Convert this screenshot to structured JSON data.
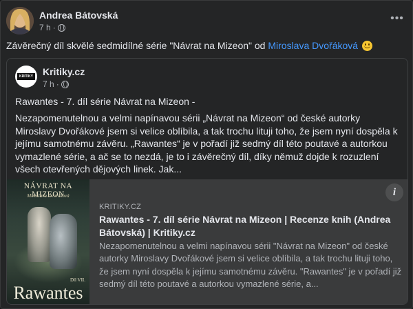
{
  "post": {
    "author": "Andrea Bátovská",
    "time": "7 h",
    "separator": "·",
    "more_label": "•••",
    "text_before": "Závěrečný díl skvělé sedmidílné série \"Návrat na Mizeon\" od ",
    "mention": "Miroslava Dvořáková",
    "emoji": "smiling-face-icon"
  },
  "shared": {
    "page_name": "Kritiky.cz",
    "time": "7 h",
    "separator": "·",
    "logo_text": "KRITIKY",
    "title": "Rawantes - 7. díl série Návrat na Mizeon -",
    "body": "Nezapomenutelnou a velmi napínavou sérii „Návrat na Mizeon“ od české autorky Miroslavy Dvořákové jsem si velice oblíbila, a tak trochu lituji toho, že jsem nyní dospěla k jejímu samotnému závěru. „Rawantes“ je v pořadí již sedmý díl této poutavé a autorkou vymazlené série, a ač se to nezdá, je to i závěrečný díl, díky němuž dojde k rozuzlení všech otevřených dějových linek. Jak..."
  },
  "link_card": {
    "domain": "KRITIKY.CZ",
    "title": "Rawantes - 7. díl série Návrat na Mizeon | Recenze knih (Andrea Bátovská) | Kritiky.cz",
    "description": "Nezapomenutelnou a velmi napínavou sérii \"Návrat na Mizeon\" od české autorky Miroslavy Dvořákové jsem si velice oblíbila, a tak trochu lituji toho, že jsem nyní dospěla k jejímu samotnému závěru. \"Rawantes\" je v pořadí již sedmý díl této poutavé a autorkou vymazlené série, a...",
    "info_label": "i",
    "cover": {
      "series_title": "NÁVRAT NA MIZEON",
      "author": "Miroslava Dvořáková",
      "part": "Díl VII.",
      "book_title": "Rawantes"
    }
  },
  "colors": {
    "background": "#242526",
    "text": "#e4e6eb",
    "secondary_text": "#b0b3b8",
    "link": "#4599ff",
    "card": "#3a3b3c"
  }
}
